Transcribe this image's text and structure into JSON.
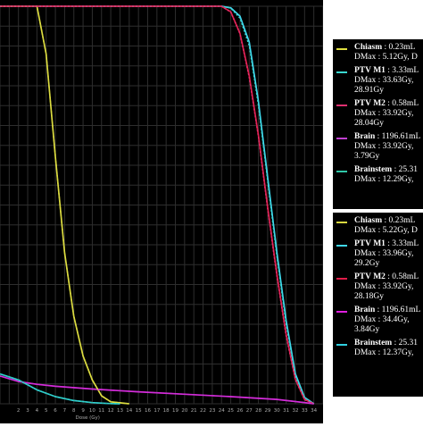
{
  "chart_data": {
    "type": "line",
    "xlabel": "Dose (Gy)",
    "ylabel": "",
    "xlim": [
      0,
      35
    ],
    "ylim": [
      0,
      100
    ],
    "x_ticks": [
      "2",
      "3",
      "4",
      "5",
      "6",
      "7",
      "8",
      "9",
      "10",
      "11",
      "12",
      "13",
      "14",
      "15",
      "16",
      "17",
      "18",
      "19",
      "20",
      "21",
      "22",
      "23",
      "24",
      "25",
      "26",
      "27",
      "28",
      "29",
      "30",
      "31",
      "32",
      "33",
      "34"
    ],
    "grid": true,
    "background": "#000000",
    "grid_color": "#2e2e2e",
    "series": [
      {
        "name": "Chiasm",
        "color": "#e0e040",
        "style": "dashed",
        "group": 1,
        "x": [
          0,
          4,
          5,
          6,
          7,
          8,
          9,
          10,
          11,
          12,
          14
        ],
        "y": [
          100,
          100,
          88,
          62,
          38,
          22,
          12,
          6,
          2,
          0.5,
          0
        ]
      },
      {
        "name": "PTV M1",
        "color": "#3ad8d0",
        "style": "dashed",
        "group": 1,
        "x": [
          0,
          24,
          25,
          26,
          27,
          28,
          29,
          30,
          31,
          32,
          33,
          34
        ],
        "y": [
          100,
          100,
          99.5,
          97,
          90,
          75,
          56,
          37,
          20,
          7,
          1.5,
          0
        ]
      },
      {
        "name": "PTV M2",
        "color": "#e03070",
        "style": "dashed",
        "group": 1,
        "x": [
          0,
          24,
          25,
          26,
          27,
          28,
          29,
          30,
          31,
          32,
          33,
          34
        ],
        "y": [
          100,
          100,
          98.5,
          93,
          82,
          67,
          49,
          32,
          17,
          6,
          1,
          0
        ]
      },
      {
        "name": "Brain",
        "color": "#c040d0",
        "style": "dashed",
        "group": 1,
        "x": [
          0,
          2,
          4,
          6,
          10,
          15,
          20,
          25,
          30,
          33,
          34
        ],
        "y": [
          7,
          5.6,
          4.9,
          4.4,
          3.7,
          3.0,
          2.4,
          1.8,
          1.1,
          0.3,
          0
        ]
      },
      {
        "name": "Brainstem",
        "color": "#30c8a8",
        "style": "dashed",
        "group": 1,
        "x": [
          0,
          2,
          4,
          6,
          8,
          10,
          12,
          13
        ],
        "y": [
          7.5,
          6,
          3.5,
          1.8,
          0.8,
          0.3,
          0.05,
          0
        ]
      },
      {
        "name": "Chiasm",
        "color": "#d8d840",
        "style": "solid",
        "group": 2,
        "x": [
          0,
          4,
          5,
          6,
          7,
          8,
          9,
          10,
          11,
          12,
          14
        ],
        "y": [
          100,
          100,
          88,
          62,
          38,
          22,
          12,
          6,
          2,
          0.5,
          0
        ]
      },
      {
        "name": "PTV M1",
        "color": "#40d8f0",
        "style": "solid",
        "group": 2,
        "x": [
          0,
          24,
          25,
          26,
          27,
          28,
          29,
          30,
          31,
          32,
          33,
          34
        ],
        "y": [
          100,
          100,
          99.6,
          97.5,
          91,
          76,
          57,
          38,
          21,
          7.5,
          1.6,
          0
        ]
      },
      {
        "name": "PTV M2",
        "color": "#e01c48",
        "style": "solid",
        "group": 2,
        "x": [
          0,
          24,
          25,
          26,
          27,
          28,
          29,
          30,
          31,
          32,
          33,
          34
        ],
        "y": [
          100,
          100,
          98.6,
          93.2,
          82.5,
          67.5,
          49.5,
          32.5,
          17.5,
          6.2,
          1.1,
          0
        ]
      },
      {
        "name": "Brain",
        "color": "#e020e0",
        "style": "solid",
        "group": 2,
        "x": [
          0,
          2,
          4,
          6,
          10,
          15,
          20,
          25,
          30,
          33,
          34
        ],
        "y": [
          7,
          5.6,
          4.9,
          4.4,
          3.7,
          3.0,
          2.4,
          1.8,
          1.1,
          0.3,
          0
        ]
      },
      {
        "name": "Brainstem",
        "color": "#30d0e0",
        "style": "solid",
        "group": 2,
        "x": [
          0,
          2,
          4,
          6,
          8,
          10,
          12,
          13
        ],
        "y": [
          7.5,
          6,
          3.5,
          1.8,
          0.8,
          0.3,
          0.05,
          0
        ]
      }
    ]
  },
  "legend_top": [
    {
      "name": "Chiasm",
      "color": "#e0e040",
      "style": "dashed",
      "lines": [
        "Chiasm : 0.23mL",
        "DMax : 5.12Gy, D"
      ]
    },
    {
      "name": "PTV M1",
      "color": "#3ad8d0",
      "style": "dashed",
      "lines": [
        "PTV M1 : 3.33mL",
        "DMax : 33.63Gy,",
        "28.91Gy"
      ]
    },
    {
      "name": "PTV M2",
      "color": "#e03070",
      "style": "dashed",
      "lines": [
        "PTV M2 : 0.58mL",
        "DMax : 33.92Gy,",
        "28.04Gy"
      ]
    },
    {
      "name": "Brain",
      "color": "#c040d0",
      "style": "dashed",
      "lines": [
        "Brain : 1196.61mL",
        "DMax : 33.92Gy,",
        "3.79Gy"
      ]
    },
    {
      "name": "Brainstem",
      "color": "#30c8a8",
      "style": "dashed",
      "lines": [
        "Brainstem : 25.31",
        "DMax : 12.29Gy,"
      ]
    }
  ],
  "legend_bottom": [
    {
      "name": "Chiasm",
      "color": "#d8d840",
      "style": "solid",
      "lines": [
        "Chiasm : 0.23mL",
        "DMax : 5.22Gy, D"
      ]
    },
    {
      "name": "PTV M1",
      "color": "#40d8f0",
      "style": "solid",
      "lines": [
        "PTV M1 : 3.33mL",
        "DMax : 33.96Gy,",
        "29.2Gy"
      ]
    },
    {
      "name": "PTV M2",
      "color": "#e01c48",
      "style": "solid",
      "lines": [
        "PTV M2 : 0.58mL",
        "DMax : 33.92Gy,",
        "28.18Gy"
      ]
    },
    {
      "name": "Brain",
      "color": "#e020e0",
      "style": "solid",
      "lines": [
        "Brain : 1196.61mL",
        "DMax : 34.4Gy,",
        "3.84Gy"
      ]
    },
    {
      "name": "Brainstem",
      "color": "#30d0e0",
      "style": "solid",
      "lines": [
        "Brainstem : 25.31",
        "DMax : 12.37Gy,"
      ]
    }
  ]
}
